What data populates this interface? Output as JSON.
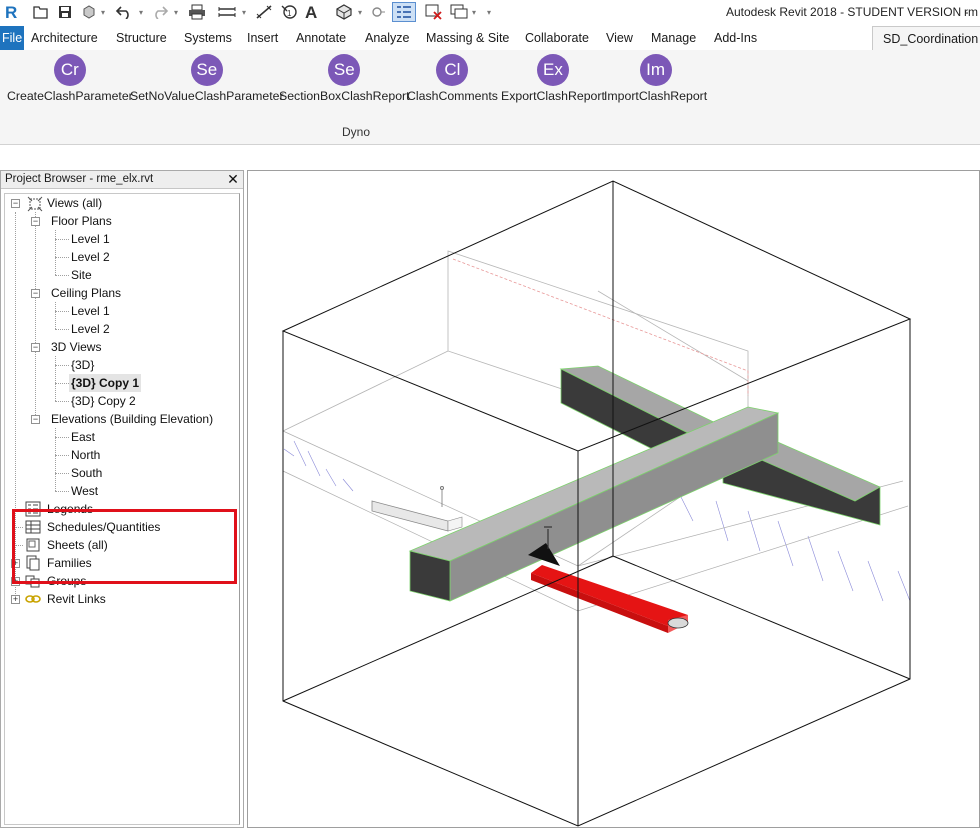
{
  "app": {
    "title": "Autodesk Revit 2018 - STUDENT VERSION -",
    "title_user": "rm"
  },
  "tabs": [
    {
      "label": "File"
    },
    {
      "label": "Architecture"
    },
    {
      "label": "Structure"
    },
    {
      "label": "Systems"
    },
    {
      "label": "Insert"
    },
    {
      "label": "Annotate"
    },
    {
      "label": "Analyze"
    },
    {
      "label": "Massing & Site"
    },
    {
      "label": "Collaborate"
    },
    {
      "label": "View"
    },
    {
      "label": "Manage"
    },
    {
      "label": "Add-Ins"
    },
    {
      "label": "SD_Coordination"
    }
  ],
  "ribbon": {
    "panel_label": "Dyno",
    "buttons": [
      {
        "abbr": "Cr",
        "label": "CreateClashParameter"
      },
      {
        "abbr": "Se",
        "label": "SetNoValueClashParameter"
      },
      {
        "abbr": "Se",
        "label": "SectionBoxClashReport"
      },
      {
        "abbr": "Cl",
        "label": "ClashComments"
      },
      {
        "abbr": "Ex",
        "label": "ExportClashReport"
      },
      {
        "abbr": "Im",
        "label": "ImportClashReport"
      }
    ],
    "button_color": "#7c58b7"
  },
  "browser": {
    "title": "Project Browser - rme_elx.rvt",
    "close": "✕",
    "tree": [
      {
        "label": "Views (all)",
        "toggle": "−"
      },
      {
        "label": "Floor Plans",
        "toggle": "−"
      },
      {
        "label": "Level 1"
      },
      {
        "label": "Level 2"
      },
      {
        "label": "Site"
      },
      {
        "label": "Ceiling Plans",
        "toggle": "−"
      },
      {
        "label": "Level 1"
      },
      {
        "label": "Level 2"
      },
      {
        "label": "3D Views",
        "toggle": "−"
      },
      {
        "label": "{3D}"
      },
      {
        "label": "{3D} Copy 1"
      },
      {
        "label": "{3D} Copy 2"
      },
      {
        "label": "Elevations (Building Elevation)",
        "toggle": "−"
      },
      {
        "label": "East"
      },
      {
        "label": "North"
      },
      {
        "label": "South"
      },
      {
        "label": "West"
      },
      {
        "label": "Legends"
      },
      {
        "label": "Schedules/Quantities"
      },
      {
        "label": "Sheets (all)"
      },
      {
        "label": "Families",
        "toggle": "+"
      },
      {
        "label": "Groups",
        "toggle": "+"
      },
      {
        "label": "Revit Links",
        "toggle": "+"
      }
    ],
    "selected": "{3D} Copy 1",
    "highlight_color": "#e0101a"
  },
  "viewport": {
    "clash_color": "#e51414",
    "duct_color": "#8f8f8f",
    "duct_dark": "#3a3a3a",
    "edge_highlight": "#7cd36b"
  }
}
